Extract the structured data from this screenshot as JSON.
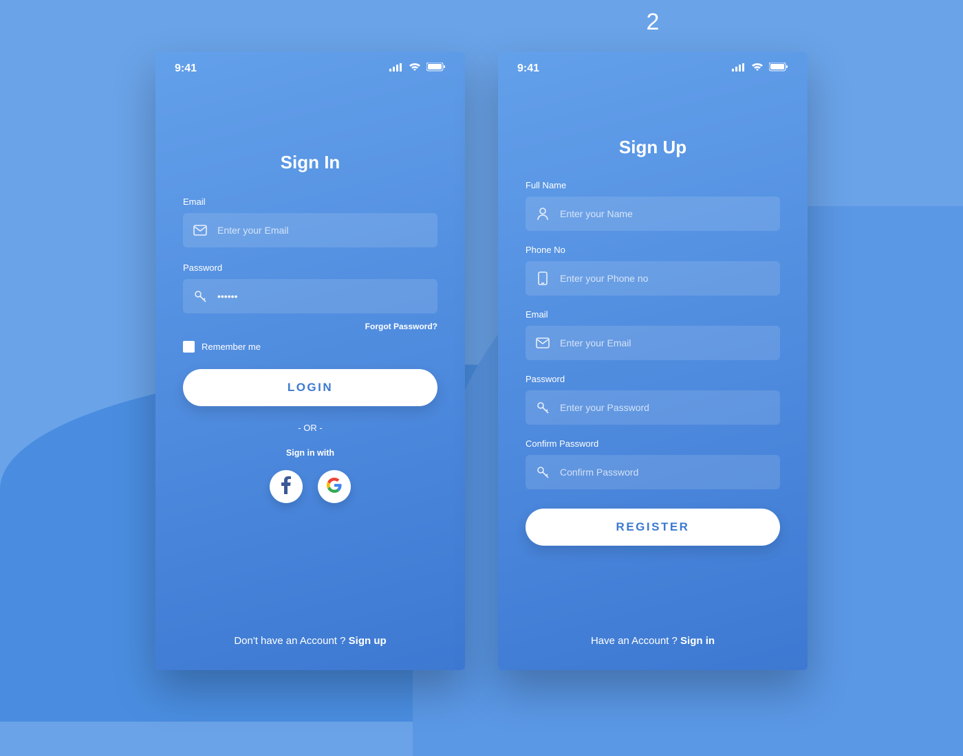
{
  "annotation": {
    "label_2": "2"
  },
  "status": {
    "time": "9:41"
  },
  "signin": {
    "title": "Sign In",
    "email_label": "Email",
    "email_placeholder": "Enter your Email",
    "password_label": "Password",
    "password_value": "••••••",
    "forgot": "Forgot Password?",
    "remember": "Remember me",
    "login_btn": "LOGIN",
    "or": "- OR -",
    "signin_with": "Sign in with",
    "footer_prefix": "Don't have an Account ? ",
    "footer_link": "Sign up"
  },
  "signup": {
    "title": "Sign Up",
    "name_label": "Full Name",
    "name_placeholder": "Enter your Name",
    "phone_label": "Phone No",
    "phone_placeholder": "Enter your Phone no",
    "email_label": "Email",
    "email_placeholder": "Enter your Email",
    "password_label": "Password",
    "password_placeholder": "Enter your Password",
    "confirm_label": "Confirm Password",
    "confirm_placeholder": "Confirm Password",
    "register_btn": "REGISTER",
    "footer_prefix": "Have an Account ? ",
    "footer_link": "Sign in"
  }
}
